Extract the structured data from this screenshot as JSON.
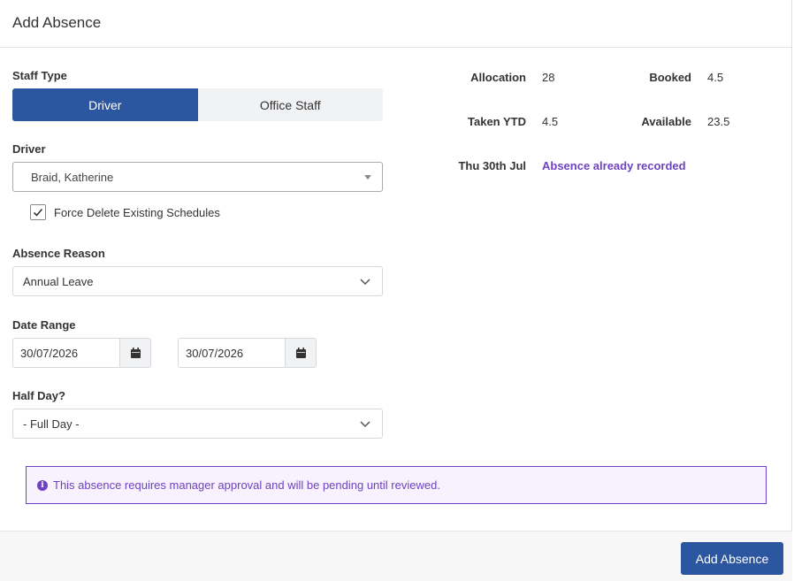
{
  "header": {
    "title": "Add Absence"
  },
  "staff_type": {
    "label": "Staff Type",
    "options": [
      "Driver",
      "Office Staff"
    ],
    "selected": "Driver"
  },
  "driver": {
    "label": "Driver",
    "value": "Braid, Katherine"
  },
  "force_delete": {
    "label": "Force Delete Existing Schedules",
    "checked": true
  },
  "absence_reason": {
    "label": "Absence Reason",
    "value": "Annual Leave"
  },
  "date_range": {
    "label": "Date Range",
    "start": "30/07/2026",
    "end": "30/07/2026"
  },
  "half_day": {
    "label": "Half Day?",
    "value": "- Full Day -"
  },
  "stats": {
    "allocation_label": "Allocation",
    "allocation_value": "28",
    "booked_label": "Booked",
    "booked_value": "4.5",
    "taken_label": "Taken YTD",
    "taken_value": "4.5",
    "available_label": "Available",
    "available_value": "23.5",
    "conflict_date": "Thu 30th Jul",
    "conflict_text": "Absence already recorded"
  },
  "alert": {
    "text": "This absence requires manager approval and will be pending until reviewed.",
    "icon": "info-icon"
  },
  "footer": {
    "submit_label": "Add Absence"
  },
  "colors": {
    "primary": "#2c57a0",
    "purple": "#6f42c1",
    "purple_bg": "#f7f2fd"
  }
}
